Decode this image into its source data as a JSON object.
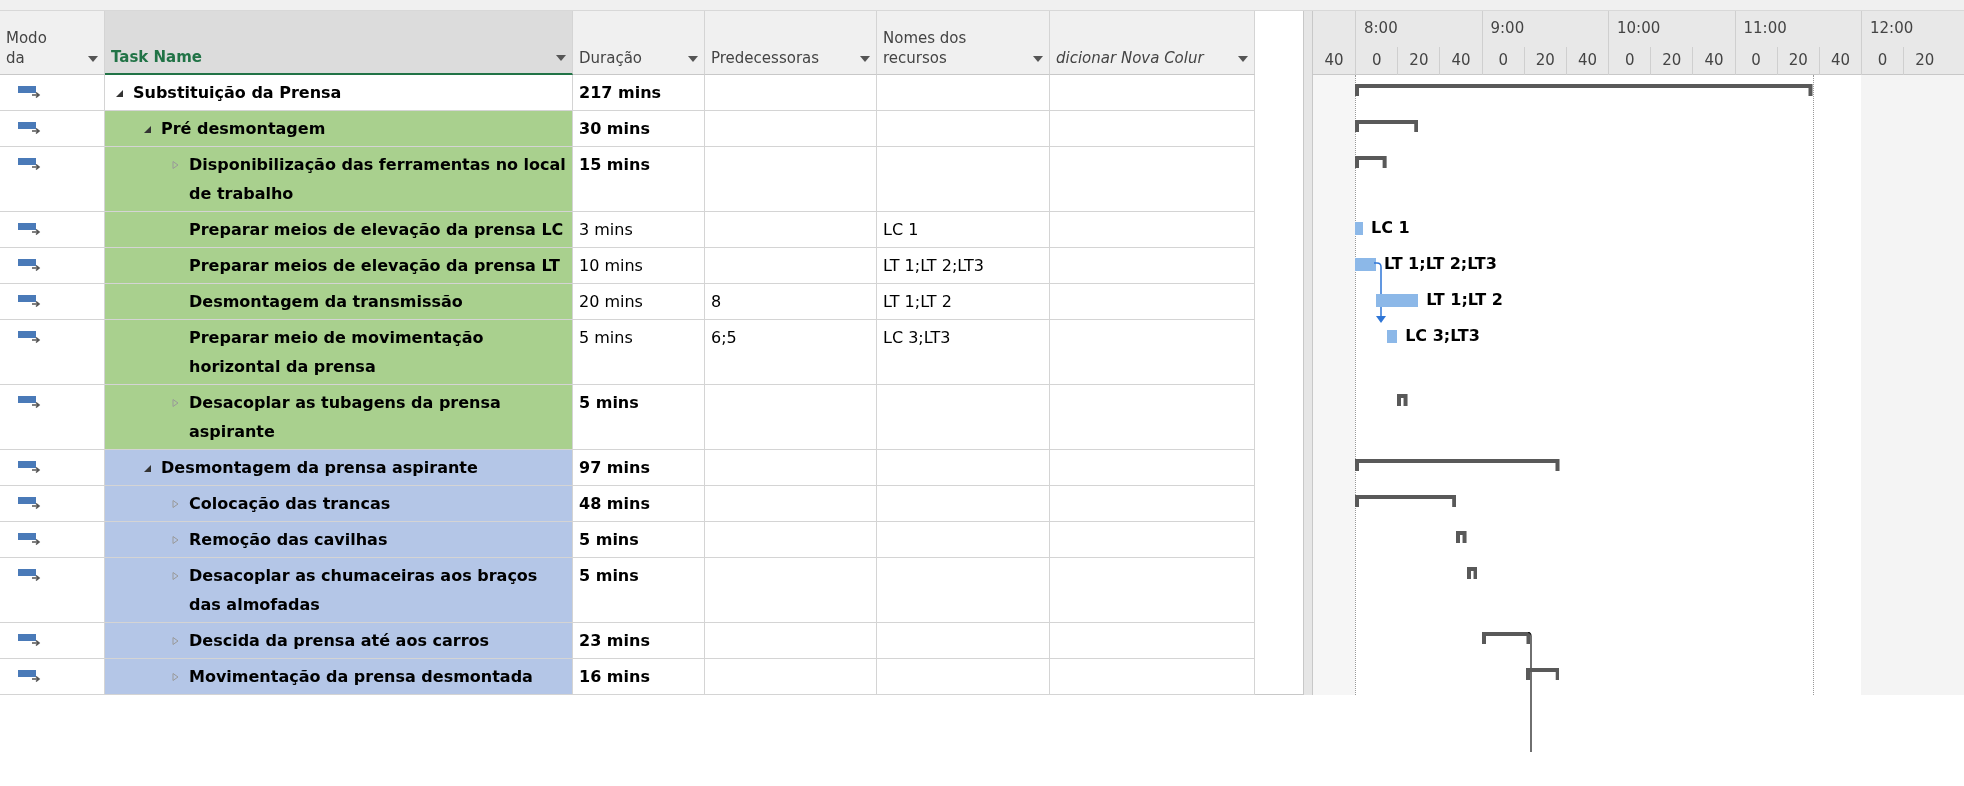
{
  "columns": [
    {
      "label": "Modo da",
      "selected": false
    },
    {
      "label": "Task Name",
      "selected": true
    },
    {
      "label": "Duração",
      "selected": false
    },
    {
      "label": "Predecessoras",
      "selected": false
    },
    {
      "label": "Nomes dos recursos",
      "selected": false
    },
    {
      "label": "dicionar Nova Colur",
      "selected": false
    }
  ],
  "timescale": {
    "hours": [
      "8:00",
      "9:00",
      "10:00",
      "11:00",
      "12:00"
    ],
    "minutes": [
      "40",
      "0",
      "20",
      "40",
      "0",
      "20",
      "40",
      "0",
      "20",
      "40",
      "0",
      "20",
      "40",
      "0",
      "20"
    ]
  },
  "tasks": [
    {
      "kind": "summary",
      "name": "Substituição da Prensa",
      "duration": "217 mins",
      "expanded": true,
      "children": [
        {
          "kind": "summary",
          "name": "Pré desmontagem",
          "duration": "30 mins",
          "expanded": true,
          "color": "#a9d08e",
          "children": [
            {
              "kind": "summary",
              "name": "Disponibilização das ferramentas no local de trabalho",
              "duration": "15 mins",
              "expanded": false
            },
            {
              "kind": "task",
              "name": "Preparar meios de elevação da prensa LC",
              "duration": "3 mins",
              "resources": "LC 1",
              "bar_label": "LC 1"
            },
            {
              "kind": "task",
              "name": "Preparar meios de elevação da prensa LT",
              "duration": "10 mins",
              "resources": "LT 1;LT 2;LT3",
              "bar_label": "LT 1;LT 2;LT3"
            },
            {
              "kind": "task",
              "name": "Desmontagem da transmissão",
              "duration": "20 mins",
              "predecessors": "8",
              "resources": "LT 1;LT 2",
              "bar_label": "LT 1;LT 2"
            },
            {
              "kind": "task",
              "name": "Preparar meio de movimentação horizontal da prensa",
              "duration": "5 mins",
              "predecessors": "6;5",
              "resources": "LC 3;LT3",
              "bar_label": "LC 3;LT3"
            },
            {
              "kind": "summary",
              "name": "Desacoplar as tubagens da prensa aspirante",
              "duration": "5 mins",
              "expanded": false
            }
          ]
        },
        {
          "kind": "summary",
          "name": "Desmontagem da prensa aspirante",
          "duration": "97 mins",
          "expanded": true,
          "color": "#b4c6e7",
          "children": [
            {
              "kind": "summary",
              "name": "Colocação das trancas",
              "duration": "48 mins",
              "expanded": false
            },
            {
              "kind": "summary",
              "name": "Remoção das cavilhas",
              "duration": "5 mins",
              "expanded": false
            },
            {
              "kind": "summary",
              "name": "Desacoplar as chumaceiras aos braços das almofadas",
              "duration": "5 mins",
              "expanded": false
            },
            {
              "kind": "summary",
              "name": "Descida da prensa até aos carros",
              "duration": "23 mins",
              "expanded": false
            },
            {
              "kind": "summary",
              "name": "Movimentação da prensa desmontada",
              "duration": "16 mins",
              "expanded": false
            }
          ]
        }
      ]
    }
  ]
}
